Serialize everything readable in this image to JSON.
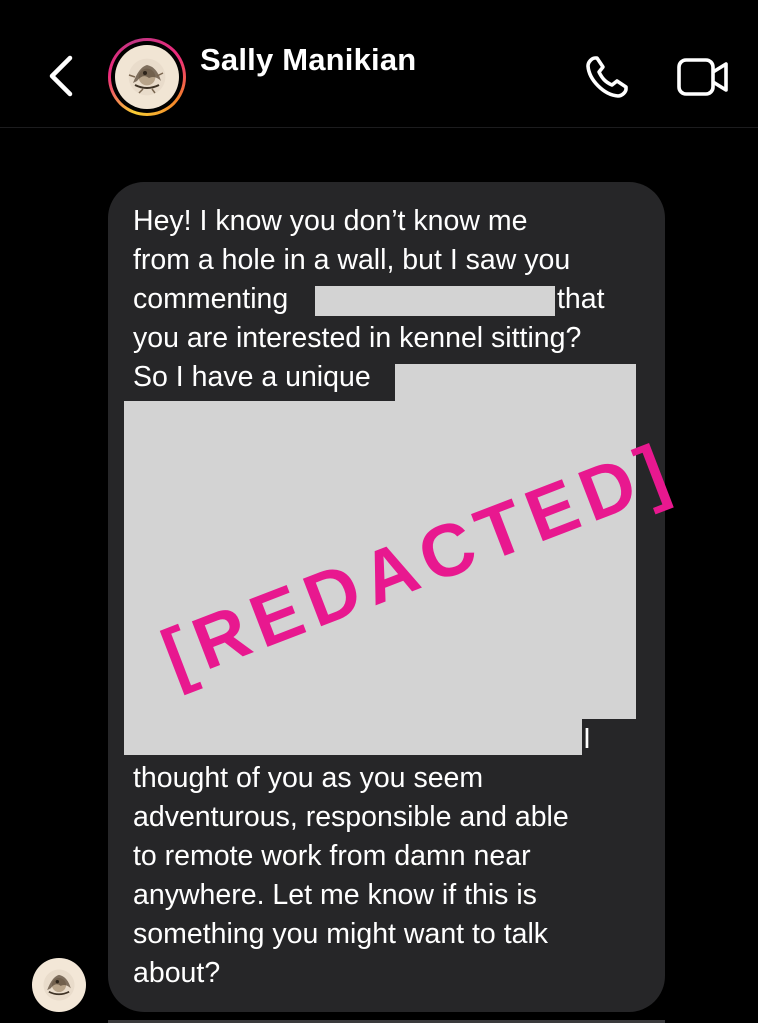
{
  "header": {
    "contact_name": "Sally Manikian",
    "back_icon": "chevron-left-icon",
    "call_icon": "phone-icon",
    "video_icon": "video-camera-icon",
    "story_ring_colors": [
      "#f9ce34",
      "#ee2a7b",
      "#c13584",
      "#f58529"
    ]
  },
  "message": {
    "line1": "Hey! I know you don’t know me",
    "line2": "from a hole in a wall, but I saw you",
    "line3_start": "commenting",
    "line3_end": "that",
    "line4": "you are interested in kennel sitting?",
    "line5": "So I have a unique",
    "line6_end": "I",
    "line7": "thought of you as you seem",
    "line8": "adventurous, responsible and able",
    "line9": "to remote work from damn near",
    "line10": "anywhere. Let me know if this is",
    "line11": "something you might want to talk",
    "line12": "about?",
    "redaction_stamp": "[REDACTED]",
    "redaction_color": "#e8188f",
    "bubble_color": "#262628"
  }
}
